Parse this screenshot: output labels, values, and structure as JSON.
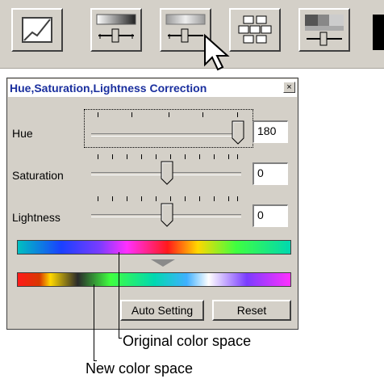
{
  "toolbar": {
    "buttons": [
      "tone-curve-icon",
      "brightness-contrast-icon",
      "hue-saturation-icon",
      "color-balance-icon",
      "variations-icon"
    ]
  },
  "dialog": {
    "title": "Hue,Saturation,Lightness Correction",
    "close_label": "×",
    "hue": {
      "label": "Hue",
      "value": "180",
      "level": 180
    },
    "saturation": {
      "label": "Saturation",
      "value": "0",
      "level": 0
    },
    "lightness": {
      "label": "Lightness",
      "value": "0",
      "level": 0
    },
    "auto_label": "Auto Setting",
    "reset_label": "Reset"
  },
  "callouts": {
    "original": "Original color space",
    "new": "New color space"
  }
}
